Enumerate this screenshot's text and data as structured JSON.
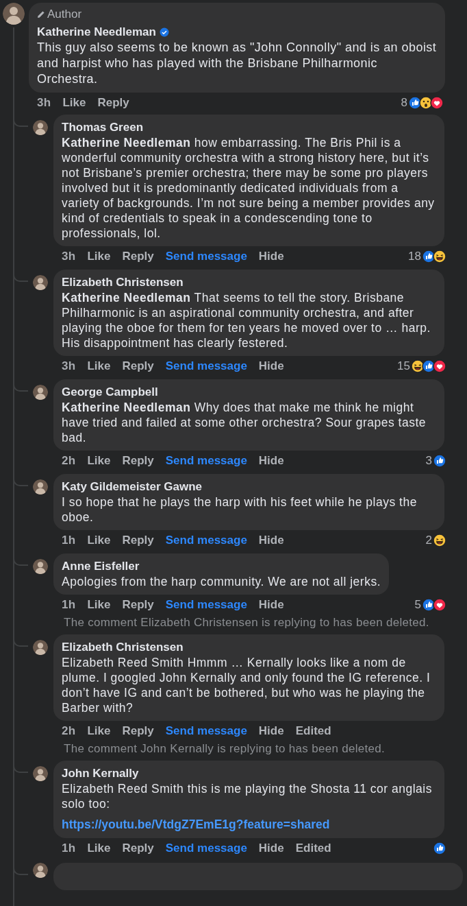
{
  "root_comment": {
    "badge": "Author",
    "author": "Katherine Needleman",
    "verified": true,
    "text": "This guy also seems to be known as \"John Connolly\" and is an oboist and harpist who has played with the Brisbane Philharmonic Orchestra.",
    "actions": [
      {
        "kind": "time",
        "label": "3h"
      },
      {
        "kind": "action",
        "label": "Like"
      },
      {
        "kind": "action",
        "label": "Reply"
      }
    ],
    "reactions": {
      "count": "8",
      "types": [
        {
          "kind": "like"
        },
        {
          "kind": "wow"
        },
        {
          "kind": "love"
        }
      ]
    }
  },
  "replies": [
    {
      "kind": "comment",
      "author": "Thomas Green",
      "text": "**Katherine Needleman** how embarrassing. The Bris Phil is a wonderful community orchestra with a strong history here, but it’s not Brisbane’s premier orchestra; there may be some pro players involved but it is predominantly dedicated individuals from a variety of backgrounds. I’m not sure being a member provides any kind of credentials to speak in a condescending tone to professionals, lol.",
      "actions": [
        {
          "kind": "time",
          "label": "3h"
        },
        {
          "kind": "action",
          "label": "Like"
        },
        {
          "kind": "action",
          "label": "Reply"
        },
        {
          "kind": "message",
          "label": "Send message"
        },
        {
          "kind": "action",
          "label": "Hide"
        }
      ],
      "reactions": {
        "count": "18",
        "types": [
          {
            "kind": "like"
          },
          {
            "kind": "haha"
          }
        ]
      }
    },
    {
      "kind": "comment",
      "author": "Elizabeth Christensen",
      "text": "**Katherine Needleman** That seems to tell the story. Brisbane Philharmonic is an aspirational community orchestra, and after playing the oboe for them for ten years he moved over to … harp.\nHis disappointment has clearly festered.",
      "actions": [
        {
          "kind": "time",
          "label": "3h"
        },
        {
          "kind": "action",
          "label": "Like"
        },
        {
          "kind": "action",
          "label": "Reply"
        },
        {
          "kind": "message",
          "label": "Send message"
        },
        {
          "kind": "action",
          "label": "Hide"
        }
      ],
      "reactions": {
        "count": "15",
        "types": [
          {
            "kind": "haha"
          },
          {
            "kind": "like"
          },
          {
            "kind": "love"
          }
        ]
      }
    },
    {
      "kind": "comment",
      "author": "George Campbell",
      "text": "**Katherine Needleman** Why does that make me think he might have tried and failed at some other orchestra? Sour grapes taste bad.",
      "actions": [
        {
          "kind": "time",
          "label": "2h"
        },
        {
          "kind": "action",
          "label": "Like"
        },
        {
          "kind": "action",
          "label": "Reply"
        },
        {
          "kind": "message",
          "label": "Send message"
        },
        {
          "kind": "action",
          "label": "Hide"
        }
      ],
      "reactions": {
        "count": "3",
        "types": [
          {
            "kind": "like"
          }
        ]
      }
    },
    {
      "kind": "comment",
      "author": "Katy Gildemeister Gawne",
      "text": "I so hope that he plays the harp with his feet while he plays the oboe.",
      "actions": [
        {
          "kind": "time",
          "label": "1h"
        },
        {
          "kind": "action",
          "label": "Like"
        },
        {
          "kind": "action",
          "label": "Reply"
        },
        {
          "kind": "message",
          "label": "Send message"
        },
        {
          "kind": "action",
          "label": "Hide"
        }
      ],
      "reactions": {
        "count": "2",
        "types": [
          {
            "kind": "haha"
          }
        ]
      }
    },
    {
      "kind": "comment",
      "author": "Anne Eisfeller",
      "text": "Apologies from the harp community. We are not all jerks.",
      "actions": [
        {
          "kind": "time",
          "label": "1h"
        },
        {
          "kind": "action",
          "label": "Like"
        },
        {
          "kind": "action",
          "label": "Reply"
        },
        {
          "kind": "message",
          "label": "Send message"
        },
        {
          "kind": "action",
          "label": "Hide"
        }
      ],
      "reactions": {
        "count": "5",
        "types": [
          {
            "kind": "like"
          },
          {
            "kind": "love"
          }
        ]
      }
    },
    {
      "kind": "deleted",
      "text": "The comment Elizabeth Christensen is replying to has been deleted."
    },
    {
      "kind": "comment",
      "author": "Elizabeth Christensen",
      "text": "Elizabeth Reed Smith Hmmm … Kernally looks like a nom de plume. I googled John Kernally and only found the IG reference. I don’t have IG and can’t be bothered, but who was he playing the Barber with?",
      "actions": [
        {
          "kind": "time",
          "label": "2h"
        },
        {
          "kind": "action",
          "label": "Like"
        },
        {
          "kind": "action",
          "label": "Reply"
        },
        {
          "kind": "message",
          "label": "Send message"
        },
        {
          "kind": "action",
          "label": "Hide"
        },
        {
          "kind": "note",
          "label": "Edited"
        }
      ]
    },
    {
      "kind": "deleted",
      "text": "The comment John Kernally is replying to has been deleted."
    },
    {
      "kind": "comment",
      "author": "John Kernally",
      "text": "Elizabeth Reed Smith this is me playing the Shosta 11 cor anglais solo too:",
      "link": "https://youtu.be/VtdgZ7EmE1g?feature=shared",
      "actions": [
        {
          "kind": "time",
          "label": "1h"
        },
        {
          "kind": "action",
          "label": "Like"
        },
        {
          "kind": "action",
          "label": "Reply"
        },
        {
          "kind": "message",
          "label": "Send message"
        },
        {
          "kind": "action",
          "label": "Hide"
        },
        {
          "kind": "note",
          "label": "Edited"
        }
      ],
      "reactions": {
        "types": [
          {
            "kind": "like"
          }
        ]
      }
    }
  ]
}
